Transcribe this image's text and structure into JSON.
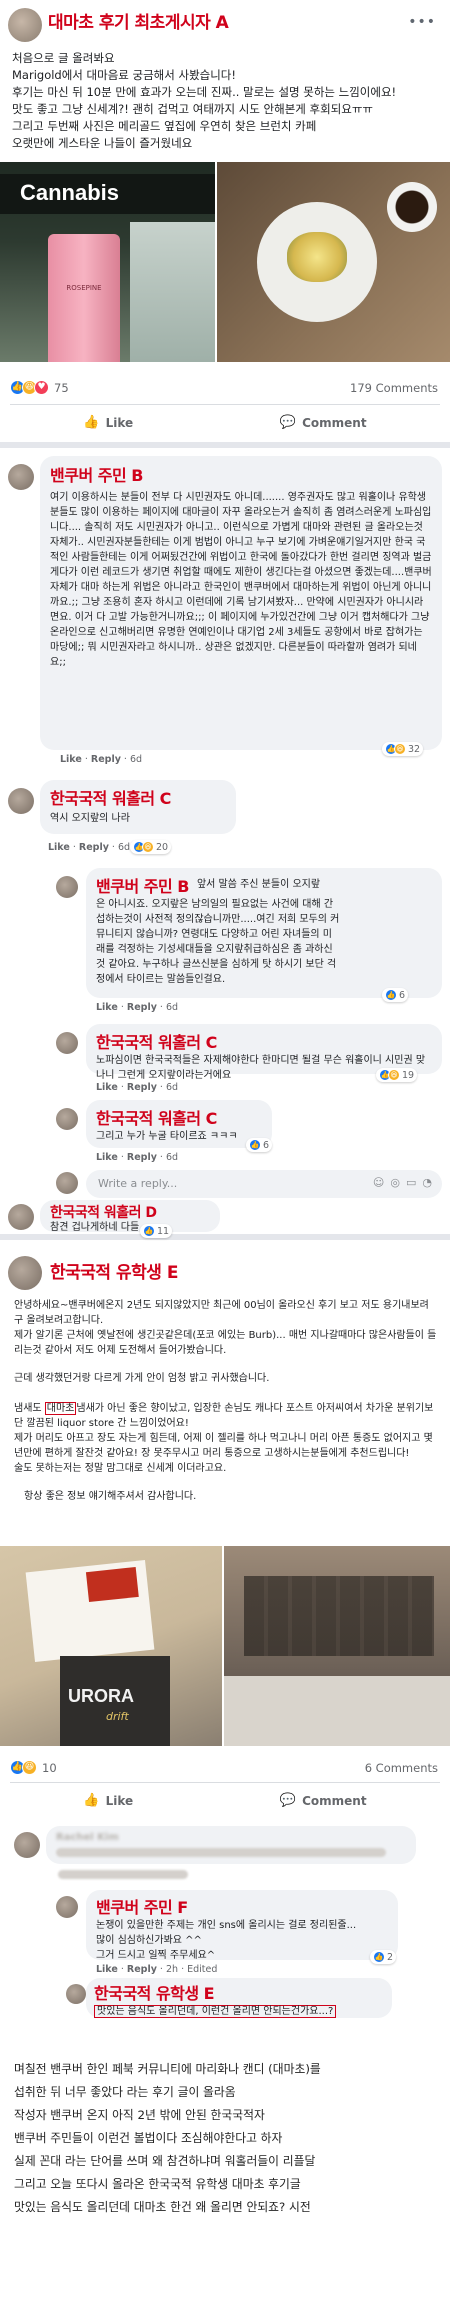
{
  "post1": {
    "title": "대마초 후기 최초게시자 A",
    "menu_icon": "more-icon",
    "lines": [
      "처음으로 글 올려봐요",
      "Marigold에서 대마음료 궁금해서 사봤습니다!",
      "후기는 마신 뒤 10분 만에 효과가 오는데 진짜.. 말로는 설명 못하는 느낌이에요!",
      "맛도 좋고 그냥 신세계?! 괜히 겁먹고 여태까지 시도 안해본게 후회되요ㅠㅠ",
      "그리고 두번째 사진은 메리골드 옆집에 우연히 찾은 브런치 카페",
      "오랫만에 게스타운 나들이 즐거웠네요"
    ],
    "photo_sign": "Cannabis",
    "photo_can_text": "ROSEPINE",
    "reaction_count": "75",
    "comments_count": "179 Comments",
    "like_label": "Like",
    "comment_label": "Comment"
  },
  "comments": [
    {
      "name": "밴쿠버 주민 B",
      "text": "여기 이용하시는 분들이 전부 다 시민권자도 아니데....... 영주권자도 많고 워홀이나 유학생분들도 많이 이용하는 페이지에 대마글이 자꾸 올라오는거 솔직히 좀 염려스러운게 노파심입니다.... 솔직히 저도 시민권자가 아니고.. 이런식으로 가볍게 대마와 관련된 글 올라오는것 자체가.. 시민권자분들한테는 이게 범법이 아니고 누구 보기에 가벼운얘기일거지만 한국 국적인 사람들한테는 이게 어쩌됬건간에 위법이고 한국에 돌아갔다가 한번 걸리면 징역과 벌금 게다가 이런 레코드가 생기면 취업할 때에도 제한이 생긴다는걸 아셨으면 좋겠는데....밴쿠버 자체가 대마 하는게 위법은 아니라고 한국인이 밴쿠버에서 대마하는게 위법이 아닌게 아니니까요.;; 그냥 조용히 혼자 하시고 이런데에 기록 남기셔봤자... 만약에 시민권자가 아니시라면요. 이거 다 고발 가능한거니까요;;; 이 페이지에 누가있건간에 그냥 이거 캡처해다가 그냥 온라인으로 신고해버리면 유명한 연예인이나 대기업 2세 3세들도 공항에서 바로 잡혀가는 마당에;; 뭐 시민권자라고 하시니까.. 상관은 없겠지만. 다른분들이 따라할까 염려가 되네요;;",
      "meta_like": "Like",
      "meta_reply": "Reply",
      "meta_time": "6d",
      "reactions": "32"
    },
    {
      "name": "한국국적 워홀러 C",
      "text": "역시 오지랖의 나라",
      "meta_like": "Like",
      "meta_reply": "Reply",
      "meta_time": "6d",
      "reactions": "20"
    },
    {
      "name": "밴쿠버 주민 B",
      "text_lines": [
        "앞서 말씀 주신 분들이 오지랖",
        "은 아니시죠. 오지랖은 남의일의 필요없는 사건에 대해 간",
        "섭하는것이 사전적 정의잖습니까만.....여긴 저희 모두의 커",
        "뮤니티지 않습니까? 연령대도 다양하고 어린 자녀들의 미",
        "래를 걱정하는 기성세대들을 오지랖취급하심은 좀 과하신",
        "것 같아요. 누구하나 글쓰신분을 심하게 탓 하시기 보단 걱",
        "정에서 타이르는 말씀들인걸요."
      ],
      "meta_like": "Like",
      "meta_reply": "Reply",
      "meta_time": "6d",
      "reactions": "6"
    },
    {
      "name": "한국국적 워홀러 C",
      "text": "노파심이면 한국국적들은 자제해야한다 한마디면 될걸 무슨 워홀이니 시민권 맞나니 그런게 오지랖이라는거에요",
      "meta_like": "Like",
      "meta_reply": "Reply",
      "meta_time": "6d",
      "reactions": "19"
    },
    {
      "name": "한국국적 워홀러 C",
      "text": "그리고 누가 누굴 타이르죠 ㅋㅋㅋ",
      "meta_like": "Like",
      "meta_reply": "Reply",
      "meta_time": "6d",
      "reactions": "6"
    },
    {
      "name": "한국국적 워홀러 D",
      "text": "참견 겁나게하네 다들",
      "meta_like": "Like",
      "meta_reply": "Reply",
      "meta_time": "6d",
      "reactions": "11"
    }
  ],
  "write_reply": {
    "placeholder": "Write a reply..."
  },
  "post2": {
    "title": "한국국적 유학생 E",
    "p1": "안녕하세요~밴쿠버에온지 2년도 되지않았지만 최근에 00님이 올라오신 후기 보고 저도 용기내보려구 올려보려고합니다.",
    "p1b": "제가 알기론 근처에 옛날전에 생긴곳같은데(포코 에있는 Burb)... 매번 지나갈때마다 많은사람들이 들리는것 같아서 저도 어제 도전해서 들어가봤습니다.",
    "p2": "근데 생각했던거랑 다르게 가게 안이 엄청 밝고 귀사했습니다.",
    "p2b_pre": "냄새도 ",
    "p2b_boxed": "대마초",
    "p2b_post": "냄새가 아닌 좋은 향이났고, 입장한 손님도 캐나다 포스트 아저씨여서 차가운 분위기보단 깔끔된 liquor store 간 느낌이었어요!",
    "p2c": "제가 머리도 아프고 장도 자는게 힘든데, 어제 이 젤리를 하나 먹고나니 머리 아픈 통증도 없어지고 몇년만에 편하게 잘잔것 같아요! 장 못주무시고 머리 통증으로 고생하시는분들에게 추천드립니다!",
    "p2d": "술도 못하는저는 정말 맘그대로 신세계 이더라고요.",
    "p3": "항상 좋은 정보 얘기해주셔서 감사합니다.",
    "photo_box_text": "URORA",
    "photo_box_sub": "drift",
    "reaction_count": "10",
    "comments_count": "6 Comments",
    "like_label": "Like",
    "comment_label": "Comment"
  },
  "post2_comments": {
    "blurred_name": "Rachel Kim",
    "c_f": {
      "name": "밴쿠버 주민 F",
      "lines": [
        "논쟁이 있을만한 주제는 개인 sns에 올리시는 걸로 정리된줄...",
        "많이 심심하신가봐요 ^^",
        "그거 드시고 일찍 주무세요^"
      ],
      "meta_like": "Like",
      "meta_reply": "Reply",
      "meta_time": "2h",
      "meta_edited": "Edited",
      "reactions": "2"
    },
    "c_e": {
      "name": "한국국적 유학생 E",
      "text": "맛있는 음식도 올리던데, 이런건 올리면 안되는건가요...?"
    }
  },
  "caption": {
    "lines": [
      "며칠전 밴쿠버 한인 페북 커뮤니티에 마리화나 캔디 (대마초)를",
      "섭취한 뒤 너무 좋았다 라는 후기 글이 올라옴",
      "작성자 밴쿠버 온지 아직 2년 밖에 안된 한국국적자",
      "밴쿠버 주민들이 이런건 볼법이다 조심해야한다고 하자",
      "실제 꼰대 라는 단어를 쓰며 왜 참견하냐며 워홀러들이 리플달",
      "그리고 오늘 또다시 올라온 한국국적 유학생 대마초 후기글",
      "맛있는 음식도 올리던데 대마초 한건 왜 올리면 안되죠? 시전"
    ]
  }
}
